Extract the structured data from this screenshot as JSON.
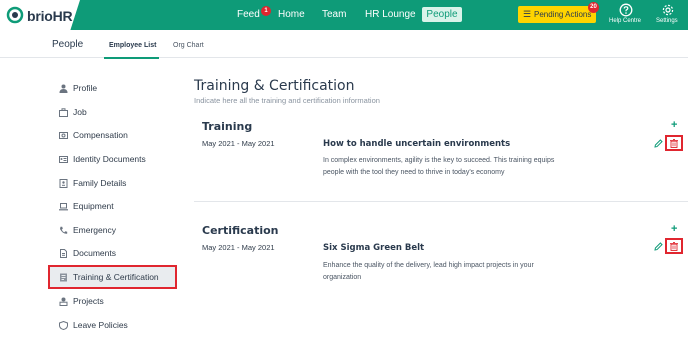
{
  "brand": {
    "logo_text": "brioHR",
    "accent": "#0e9b78",
    "alert": "#e0262f"
  },
  "nav": {
    "items": [
      {
        "label": "Feed",
        "badge": "1"
      },
      {
        "label": "Home"
      },
      {
        "label": "Team"
      },
      {
        "label": "HR Lounge"
      },
      {
        "label": "People",
        "active": true
      }
    ],
    "pending": {
      "label": "Pending Actions",
      "badge": "20"
    },
    "help": {
      "label": "Help Centre",
      "icon": "question-icon"
    },
    "settings": {
      "label": "Settings",
      "icon": "gear-icon"
    }
  },
  "subnav": {
    "title": "People",
    "tabs": [
      {
        "label": "Employee List",
        "active": true
      },
      {
        "label": "Org Chart"
      }
    ]
  },
  "sidebar": {
    "items": [
      {
        "label": "Profile",
        "icon": "user-icon"
      },
      {
        "label": "Job",
        "icon": "briefcase-icon"
      },
      {
        "label": "Compensation",
        "icon": "money-icon"
      },
      {
        "label": "Identity Documents",
        "icon": "id-card-icon"
      },
      {
        "label": "Family Details",
        "icon": "contact-book-icon"
      },
      {
        "label": "Equipment",
        "icon": "laptop-icon"
      },
      {
        "label": "Emergency",
        "icon": "phone-icon"
      },
      {
        "label": "Documents",
        "icon": "document-icon"
      },
      {
        "label": "Training & Certification",
        "icon": "certificate-icon",
        "selected": true
      },
      {
        "label": "Projects",
        "icon": "project-icon"
      },
      {
        "label": "Leave Policies",
        "icon": "policy-icon"
      }
    ]
  },
  "main": {
    "title": "Training & Certification",
    "subtitle": "Indicate here all the training and certification information",
    "sections": [
      {
        "title": "Training",
        "entries": [
          {
            "date": "May 2021 - May 2021",
            "name": "How to handle uncertain environments",
            "description": "In complex environments, agility is the key to succeed. This training equips people with the tool they need to thrive in today's economy"
          }
        ]
      },
      {
        "title": "Certification",
        "entries": [
          {
            "date": "May 2021 - May 2021",
            "name": "Six Sigma Green Belt",
            "description": "Enhance the quality of the delivery, lead high impact projects in your organization"
          }
        ]
      }
    ],
    "add_symbol": "+"
  }
}
